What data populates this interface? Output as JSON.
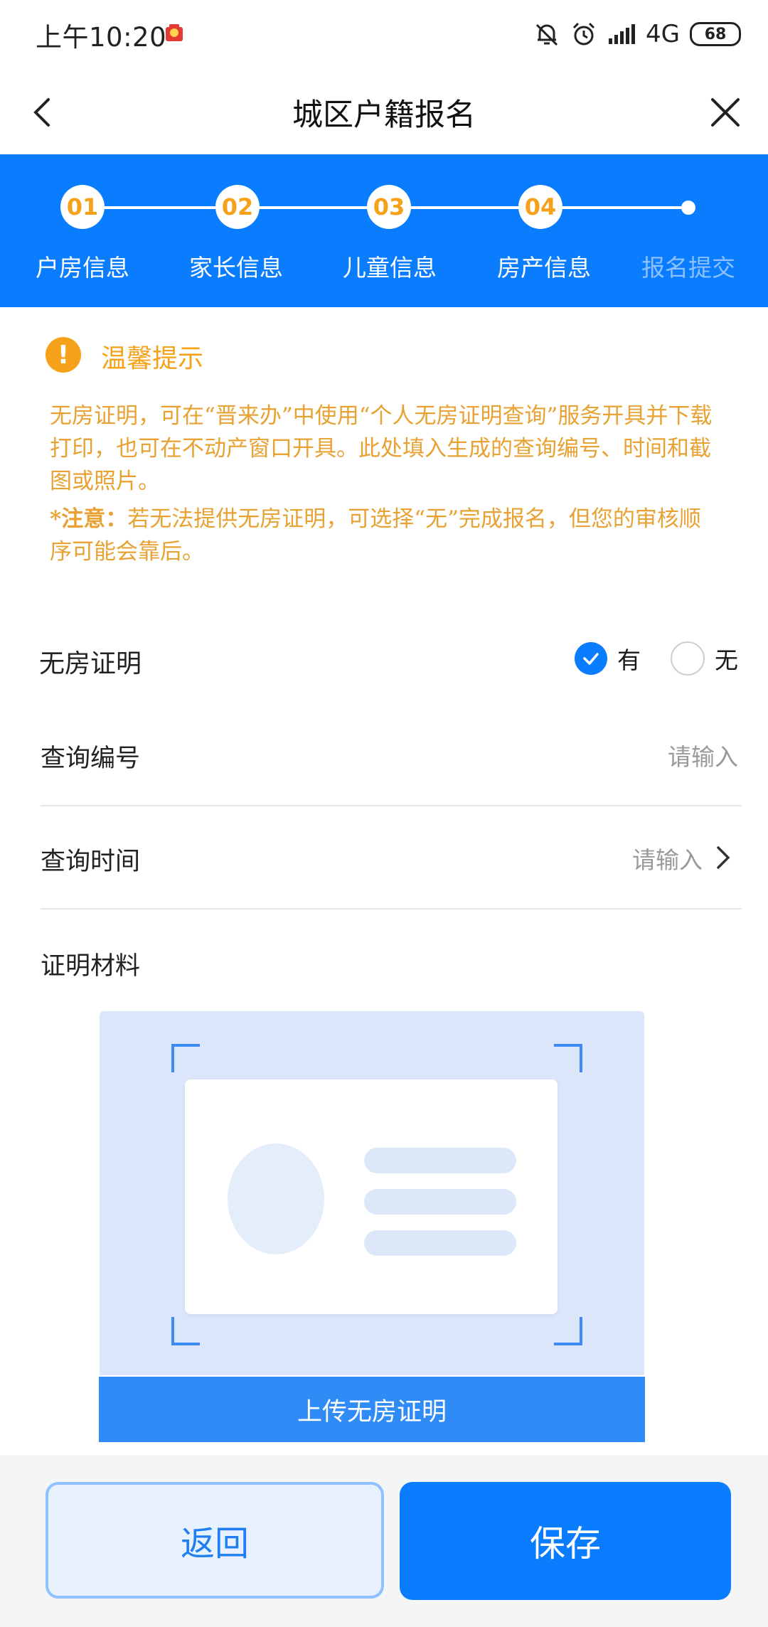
{
  "status_bar": {
    "time": "上午10:20",
    "network": "4G",
    "battery": "68"
  },
  "nav": {
    "title": "城区户籍报名",
    "back_icon": "chevron-left-icon",
    "close_icon": "close-icon"
  },
  "steps": [
    {
      "num": "01",
      "label": "户房信息"
    },
    {
      "num": "02",
      "label": "家长信息"
    },
    {
      "num": "03",
      "label": "儿童信息"
    },
    {
      "num": "04",
      "label": "房产信息"
    },
    {
      "num": "",
      "label": "报名提交"
    }
  ],
  "tips": {
    "title": "温馨提示",
    "text": "无房证明，可在“晋来办”中使用“个人无房证明查询”服务开具并下载打印，也可在不动产窗口开具。此处填入生成的查询编号、时间和截图或照片。",
    "note_prefix": "*注意：",
    "note_text": "若无法提供无房证明，可选择“无”完成报名，但您的审核顺序可能会靠后。"
  },
  "form": {
    "no_house_label": "无房证明",
    "option_yes": "有",
    "option_no": "无",
    "selected": "有",
    "query_no_label": "查询编号",
    "query_no_placeholder": "请输入",
    "query_time_label": "查询时间",
    "query_time_placeholder": "请输入",
    "material_label": "证明材料",
    "upload_button": "上传无房证明"
  },
  "actions": {
    "back": "返回",
    "save": "保存"
  },
  "colors": {
    "primary": "#0a7dff",
    "warning": "#f5a21a",
    "tip_text": "#e8a233"
  }
}
